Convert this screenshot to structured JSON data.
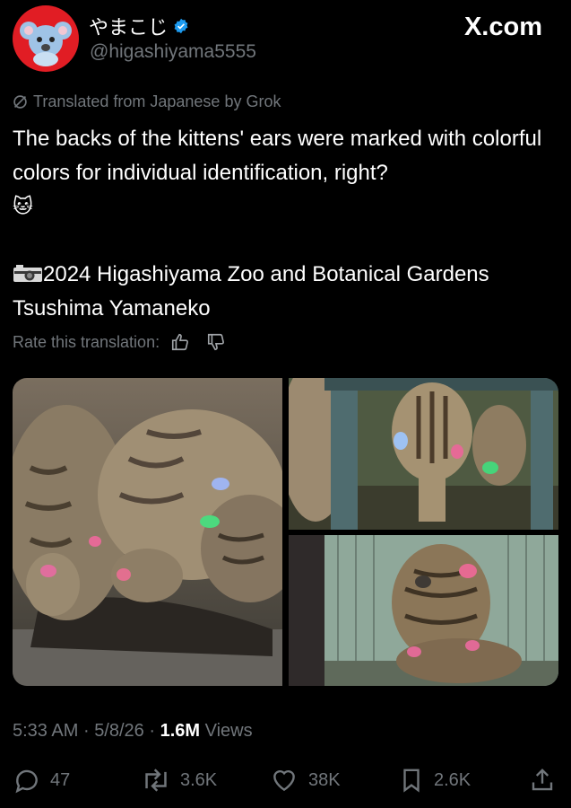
{
  "author": {
    "display_name": "やまこじ",
    "handle": "@higashiyama5555"
  },
  "site": "X.com",
  "translation_note": "Translated from Japanese by Grok",
  "post": {
    "line1": "The backs of the kittens' ears were marked with colorful colors for individual identification, right?",
    "emoji": "🐱",
    "line2": "2024 Higashiyama Zoo and Botanical Gardens Tsushima Yamaneko"
  },
  "rate_label": "Rate this translation:",
  "meta": {
    "time": "5:33 AM",
    "date": "5/8/26",
    "separator": "·",
    "views_count": "1.6M",
    "views_label": "Views"
  },
  "actions": {
    "replies": "47",
    "reposts": "3.6K",
    "likes": "38K",
    "bookmarks": "2.6K"
  },
  "colors": {
    "background": "#000000",
    "text": "#e7e9ea",
    "secondary": "#71767b",
    "verified": "#1d9bf0",
    "avatar": "#e11d24"
  }
}
